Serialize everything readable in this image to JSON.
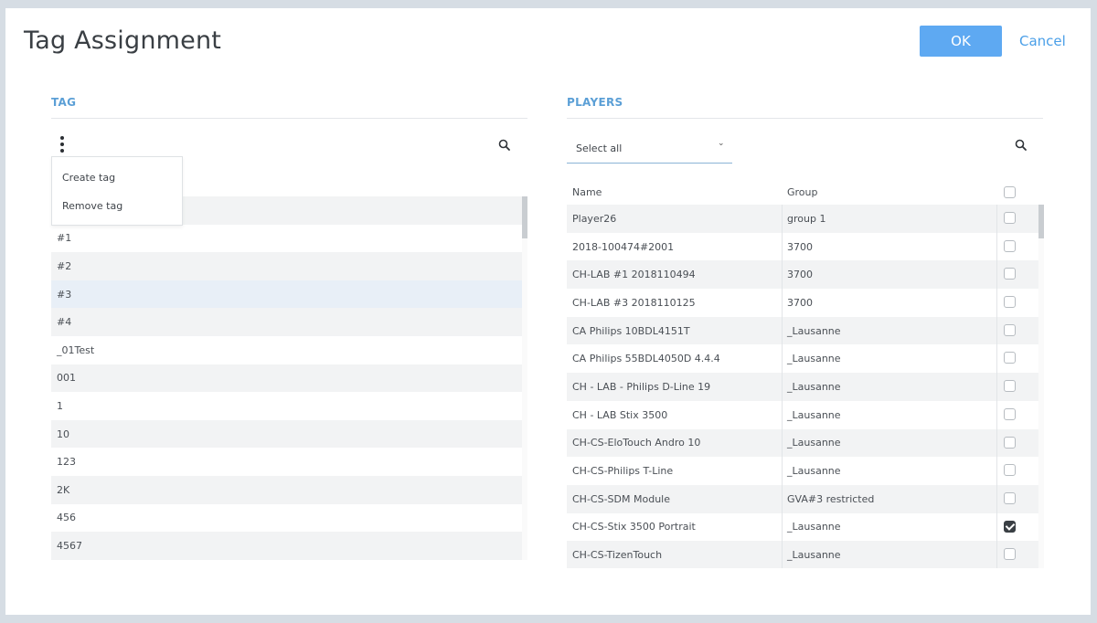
{
  "dialog": {
    "title": "Tag Assignment",
    "ok_label": "OK",
    "cancel_label": "Cancel"
  },
  "tag_panel": {
    "section_title": "TAG",
    "menu_icon": "kebab-menu-icon",
    "search_icon": "search-icon",
    "menu_items": [
      "Create tag",
      "Remove tag"
    ],
    "tags": [
      "",
      "#1",
      "#2",
      "#3",
      "#4",
      "_01Test",
      "001",
      "1",
      "10",
      "123",
      "2K",
      "456",
      "4567"
    ],
    "selected_tag": "#3"
  },
  "players_panel": {
    "section_title": "PLAYERS",
    "select_all_label": "Select all",
    "search_icon": "search-icon",
    "columns": {
      "name": "Name",
      "group": "Group"
    },
    "players": [
      {
        "name": "Player26",
        "group": "group 1",
        "checked": false
      },
      {
        "name": "2018-100474#2001",
        "group": "3700",
        "checked": false
      },
      {
        "name": "CH-LAB #1 2018110494",
        "group": "3700",
        "checked": false
      },
      {
        "name": "CH-LAB #3 2018110125",
        "group": "3700",
        "checked": false
      },
      {
        "name": "CA Philips 10BDL4151T",
        "group": "_Lausanne",
        "checked": false
      },
      {
        "name": "CA Philips 55BDL4050D 4.4.4",
        "group": "_Lausanne",
        "checked": false
      },
      {
        "name": "CH - LAB - Philips D-Line 19",
        "group": "_Lausanne",
        "checked": false
      },
      {
        "name": "CH - LAB Stix 3500",
        "group": "_Lausanne",
        "checked": false
      },
      {
        "name": "CH-CS-EloTouch Andro 10",
        "group": "_Lausanne",
        "checked": false
      },
      {
        "name": "CH-CS-Philips T-Line",
        "group": "_Lausanne",
        "checked": false
      },
      {
        "name": "CH-CS-SDM Module",
        "group": "GVA#3 restricted",
        "checked": false
      },
      {
        "name": "CH-CS-Stix 3500 Portrait",
        "group": "_Lausanne",
        "checked": true
      },
      {
        "name": "CH-CS-TizenTouch",
        "group": "_Lausanne",
        "checked": false
      }
    ]
  },
  "colors": {
    "accent": "#5ea9f2",
    "link": "#4a9fe8",
    "section_title": "#5b9fd6",
    "row_alt": "#f2f3f4",
    "row_selected": "#e8eff7"
  }
}
